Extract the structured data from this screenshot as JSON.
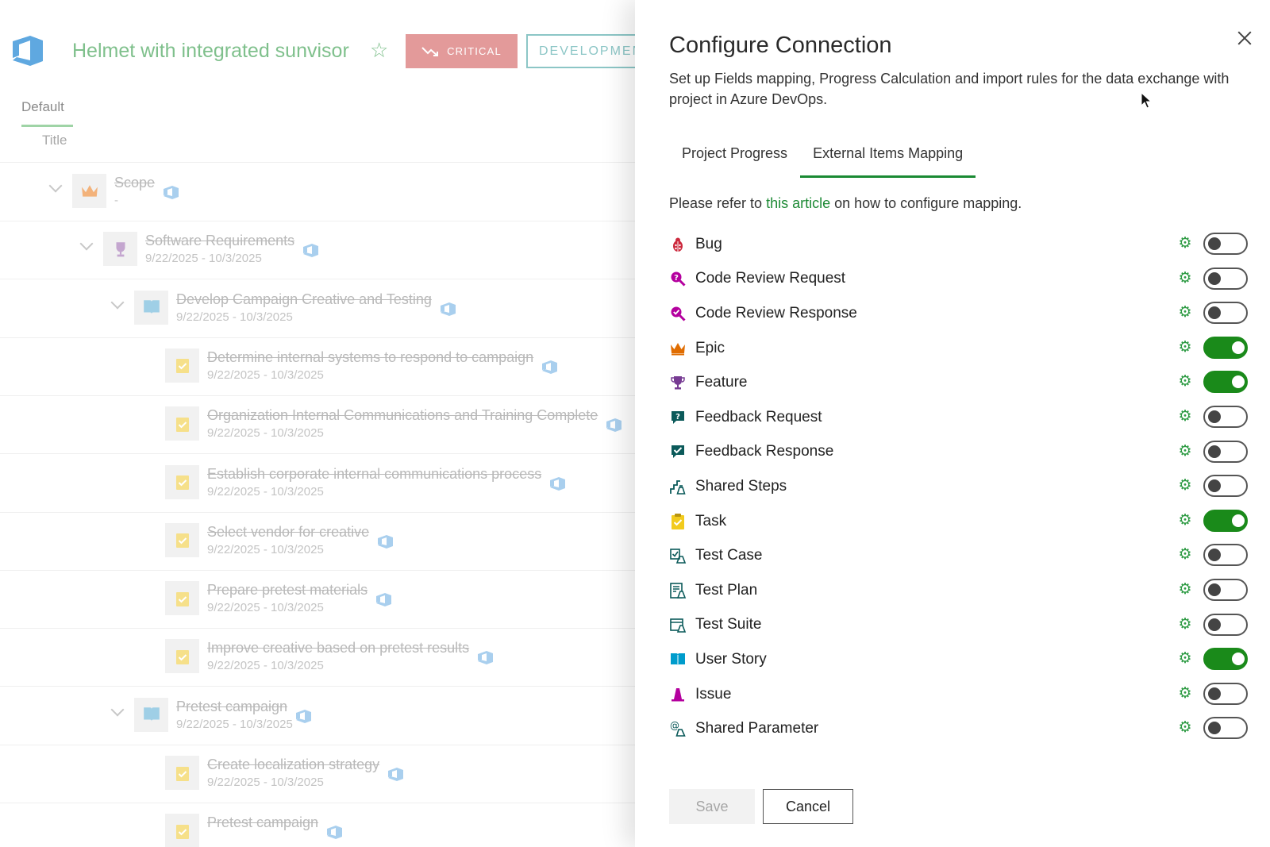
{
  "background": {
    "project_title": "Helmet with integrated sunvisor",
    "critical_label": "CRITICAL",
    "development_label": "DEVELOPMEN",
    "view_tab": "Default",
    "column_header": "Title",
    "tree": [
      {
        "title": "Scope",
        "dates": "-",
        "kind": "epic",
        "level": 0,
        "expandable": true
      },
      {
        "title": "Software Requirements",
        "dates": "9/22/2025 - 10/3/2025",
        "kind": "feature",
        "level": 1,
        "expandable": true
      },
      {
        "title": "Develop Campaign Creative and Testing",
        "dates": "9/22/2025 - 10/3/2025",
        "kind": "story",
        "level": 2,
        "expandable": true
      },
      {
        "title": "Determine internal systems to respond to campaign",
        "dates": "9/22/2025 - 10/3/2025",
        "kind": "task",
        "level": 3,
        "expandable": false
      },
      {
        "title": "Organization Internal Communications and Training Complete",
        "dates": "9/22/2025 - 10/3/2025",
        "kind": "task",
        "level": 3,
        "expandable": false
      },
      {
        "title": "Establish corporate internal communications process",
        "dates": "9/22/2025 - 10/3/2025",
        "kind": "task",
        "level": 3,
        "expandable": false
      },
      {
        "title": "Select vendor for creative",
        "dates": "9/22/2025 - 10/3/2025",
        "kind": "task",
        "level": 3,
        "expandable": false
      },
      {
        "title": "Prepare pretest materials",
        "dates": "9/22/2025 - 10/3/2025",
        "kind": "task",
        "level": 3,
        "expandable": false
      },
      {
        "title": "Improve creative based on pretest results",
        "dates": "9/22/2025 - 10/3/2025",
        "kind": "task",
        "level": 3,
        "expandable": false
      },
      {
        "title": "Pretest campaign",
        "dates": "9/22/2025 - 10/3/2025",
        "kind": "story",
        "level": 2,
        "expandable": true
      },
      {
        "title": "Create localization strategy",
        "dates": "9/22/2025 - 10/3/2025",
        "kind": "task",
        "level": 3,
        "expandable": false
      },
      {
        "title": "Pretest campaign",
        "dates": "",
        "kind": "task",
        "level": 3,
        "expandable": false
      }
    ]
  },
  "panel": {
    "title": "Configure Connection",
    "description": "Set up Fields mapping, Progress Calculation and import rules for the data exchange with project in Azure DevOps.",
    "tabs": [
      {
        "label": "Project Progress",
        "active": false
      },
      {
        "label": "External Items Mapping",
        "active": true
      }
    ],
    "refer_prefix": "Please refer to ",
    "refer_link": "this article",
    "refer_suffix": " on how to configure mapping.",
    "mappings": [
      {
        "label": "Bug",
        "icon": "bug-icon",
        "enabled": false
      },
      {
        "label": "Code Review Request",
        "icon": "code-review-request-icon",
        "enabled": false
      },
      {
        "label": "Code Review Response",
        "icon": "code-review-response-icon",
        "enabled": false
      },
      {
        "label": "Epic",
        "icon": "crown-icon",
        "enabled": true
      },
      {
        "label": "Feature",
        "icon": "trophy-icon",
        "enabled": true
      },
      {
        "label": "Feedback Request",
        "icon": "feedback-request-icon",
        "enabled": false
      },
      {
        "label": "Feedback Response",
        "icon": "feedback-response-icon",
        "enabled": false
      },
      {
        "label": "Shared Steps",
        "icon": "shared-steps-icon",
        "enabled": false
      },
      {
        "label": "Task",
        "icon": "clipboard-icon",
        "enabled": true
      },
      {
        "label": "Test Case",
        "icon": "test-case-icon",
        "enabled": false
      },
      {
        "label": "Test Plan",
        "icon": "test-plan-icon",
        "enabled": false
      },
      {
        "label": "Test Suite",
        "icon": "test-suite-icon",
        "enabled": false
      },
      {
        "label": "User Story",
        "icon": "book-icon",
        "enabled": true
      },
      {
        "label": "Issue",
        "icon": "issue-icon",
        "enabled": false
      },
      {
        "label": "Shared Parameter",
        "icon": "shared-parameter-icon",
        "enabled": false
      }
    ],
    "save_label": "Save",
    "cancel_label": "Cancel"
  },
  "colors": {
    "accent_green": "#1a8a1a",
    "link_green": "#1d8a35",
    "critical_bg": "#e39a9a"
  }
}
